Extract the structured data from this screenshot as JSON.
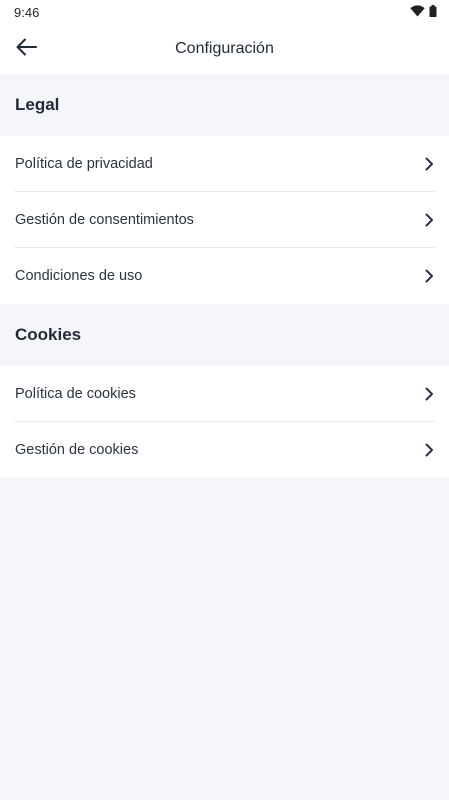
{
  "status_bar": {
    "time": "9:46",
    "wifi_icon": "wifi-icon",
    "battery_icon": "battery-icon"
  },
  "header": {
    "title": "Configuración",
    "back_icon": "arrow-back-icon"
  },
  "sections": [
    {
      "title": "Legal",
      "items": [
        {
          "label": "Política de privacidad",
          "icon": "chevron-right-icon"
        },
        {
          "label": "Gestión de consentimientos",
          "icon": "chevron-right-icon"
        },
        {
          "label": "Condiciones de uso",
          "icon": "chevron-right-icon"
        }
      ]
    },
    {
      "title": "Cookies",
      "items": [
        {
          "label": "Política de cookies",
          "icon": "chevron-right-icon"
        },
        {
          "label": "Gestión de cookies",
          "icon": "chevron-right-icon"
        }
      ]
    }
  ],
  "colors": {
    "background": "#f5f6fa",
    "surface": "#ffffff",
    "text": "#1f2a37",
    "divider": "#e8eaef"
  }
}
